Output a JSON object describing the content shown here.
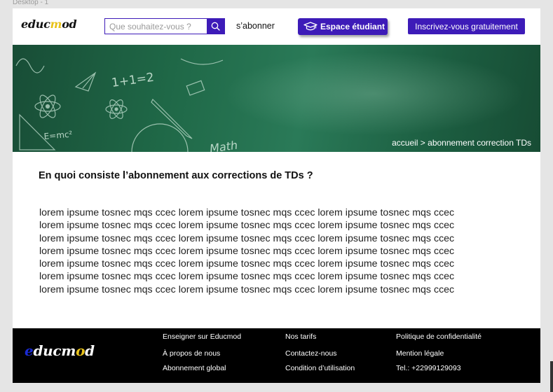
{
  "artboard_label": "Desktop - 1",
  "header": {
    "logo": {
      "pre": "educ",
      "highlight": "m",
      "post": "od"
    },
    "search_placeholder": "Que souhaitez-vous ?",
    "subscribe_label": "s’abonner",
    "student_space_label": "Espace étudiant",
    "register_label": "Inscrivez-vous gratuitement"
  },
  "hero": {
    "doodles": [
      "1+1=2",
      "E=mc²",
      "Math"
    ],
    "breadcrumb": "accueil > abonnement correction TDs"
  },
  "main": {
    "title": "En quoi consiste l’abonnement aux corrections de TDs ?",
    "paragraph_lines": [
      "lorem ipsume tosnec mqs ccec  lorem ipsume tosnec mqs ccec  lorem ipsume tosnec mqs ccec",
      "lorem ipsume tosnec mqs ccec lorem ipsume tosnec mqs ccec lorem ipsume tosnec mqs ccec",
      "lorem ipsume tosnec mqs ccec lorem ipsume tosnec mqs ccec lorem ipsume tosnec mqs ccec",
      "lorem ipsume tosnec mqs ccec lorem ipsume tosnec mqs ccec lorem ipsume tosnec mqs ccec",
      "lorem ipsume tosnec mqs ccec lorem ipsume tosnec mqs ccec lorem ipsume tosnec mqs ccec",
      "lorem ipsume tosnec mqs ccec lorem ipsume tosnec mqs ccec lorem ipsume tosnec mqs ccec",
      "lorem ipsume tosnec mqs ccec lorem ipsume tosnec mqs ccec lorem ipsume tosnec mqs ccec"
    ]
  },
  "footer": {
    "logo": {
      "first": "e",
      "mid": "ducm",
      "accent": "o",
      "last": "d"
    },
    "col1": [
      "Enseigner sur Educmod",
      "À propos de nous",
      "Abonnement global"
    ],
    "col2": [
      "Nos tarifs",
      "Contactez-nous",
      "Condition d’utilisation"
    ],
    "col3": [
      "Politique de confidentialité",
      "Mention légale",
      "Tel.:   +22999129093"
    ]
  },
  "colors": {
    "brand_purple": "#3d1bb8",
    "hero_green": "#1f6847",
    "logo_yellow": "#e8c21a",
    "footer_bg": "#000000"
  },
  "icons": [
    "search-icon",
    "graduation-cap-icon"
  ]
}
